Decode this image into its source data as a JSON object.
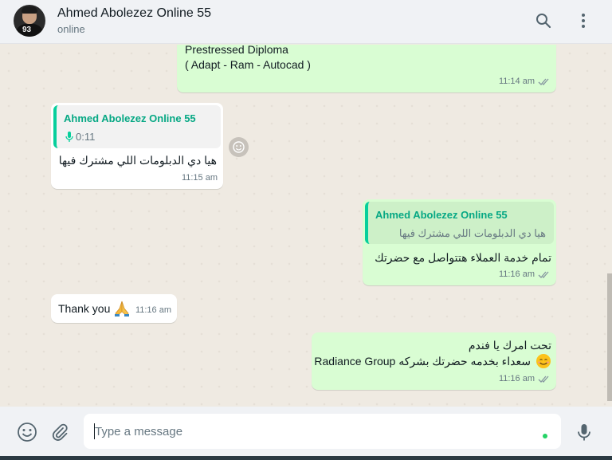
{
  "header": {
    "contact_name": "Ahmed Abolezez Online 55",
    "status": "online",
    "avatar_number": "93"
  },
  "messages": [
    {
      "direction": "outgoing",
      "lines": [
        "Prestressed Diploma",
        "( Adapt - Ram - Autocad  )"
      ],
      "time": "11:14 am",
      "read": true
    },
    {
      "direction": "incoming",
      "quote": {
        "author": "Ahmed Abolezez Online 55",
        "voice_duration": "0:11"
      },
      "text": "هيا دي الدبلومات اللي مشترك فيها",
      "time": "11:15 am"
    },
    {
      "direction": "outgoing",
      "quote": {
        "author": "Ahmed Abolezez Online 55",
        "text": "هيا دي الدبلومات اللي مشترك فيها"
      },
      "text": "تمام خدمة العملاء هتتواصل مع حضرتك",
      "time": "11:16 am",
      "read": true
    },
    {
      "direction": "incoming",
      "text": "Thank you",
      "emoji": "folded-hands",
      "time": "11:16 am"
    },
    {
      "direction": "outgoing",
      "lines": [
        "تحت امرك يا فندم",
        "سعداء بخدمه حضرتك بشركه Radiance Group"
      ],
      "emoji": "smiling-face",
      "time": "11:16 am",
      "read": true
    }
  ],
  "composer": {
    "placeholder": "Type a message"
  },
  "colors": {
    "outgoing_bubble": "#d9fdd3",
    "incoming_bubble": "#ffffff",
    "accent": "#06a884",
    "read_ticks": "#8696a0"
  }
}
